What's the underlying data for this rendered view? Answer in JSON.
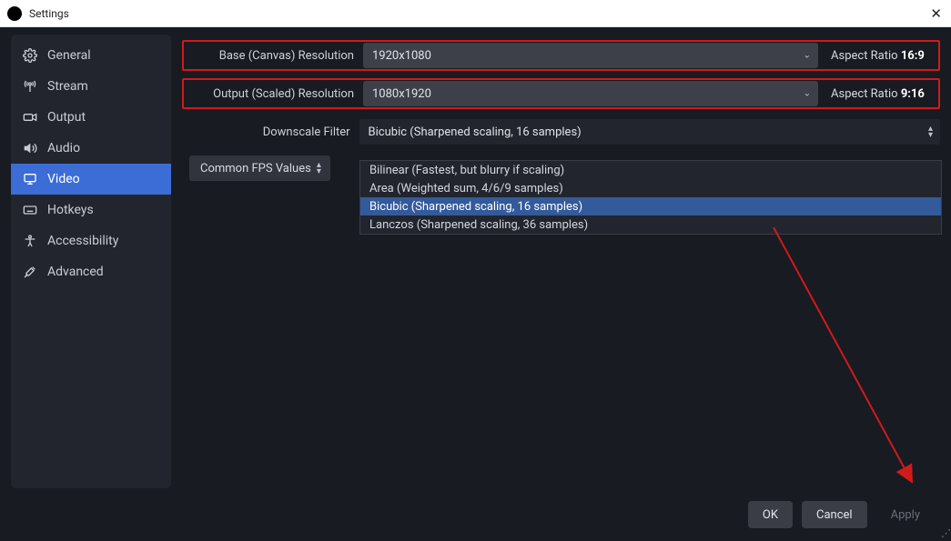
{
  "titlebar": {
    "title": "Settings"
  },
  "sidebar": {
    "items": [
      {
        "label": "General",
        "icon": "gear-icon"
      },
      {
        "label": "Stream",
        "icon": "antenna-icon"
      },
      {
        "label": "Output",
        "icon": "camera-icon"
      },
      {
        "label": "Audio",
        "icon": "speaker-icon"
      },
      {
        "label": "Video",
        "icon": "monitor-icon",
        "selected": true
      },
      {
        "label": "Hotkeys",
        "icon": "keyboard-icon"
      },
      {
        "label": "Accessibility",
        "icon": "accessibility-icon"
      },
      {
        "label": "Advanced",
        "icon": "tools-icon"
      }
    ]
  },
  "video": {
    "base_label": "Base (Canvas) Resolution",
    "base_value": "1920x1080",
    "base_aspect_label": "Aspect Ratio ",
    "base_aspect_value": "16:9",
    "output_label": "Output (Scaled) Resolution",
    "output_value": "1080x1920",
    "output_aspect_label": "Aspect Ratio ",
    "output_aspect_value": "9:16",
    "downscale_label": "Downscale Filter",
    "downscale_value": "Bicubic (Sharpened scaling, 16 samples)",
    "downscale_options": [
      "Bilinear (Fastest, but blurry if scaling)",
      "Area (Weighted sum, 4/6/9 samples)",
      "Bicubic (Sharpened scaling, 16 samples)",
      "Lanczos (Sharpened scaling, 36 samples)"
    ],
    "downscale_selected_index": 2,
    "fps_label": "Common FPS Values"
  },
  "footer": {
    "ok": "OK",
    "cancel": "Cancel",
    "apply": "Apply"
  }
}
